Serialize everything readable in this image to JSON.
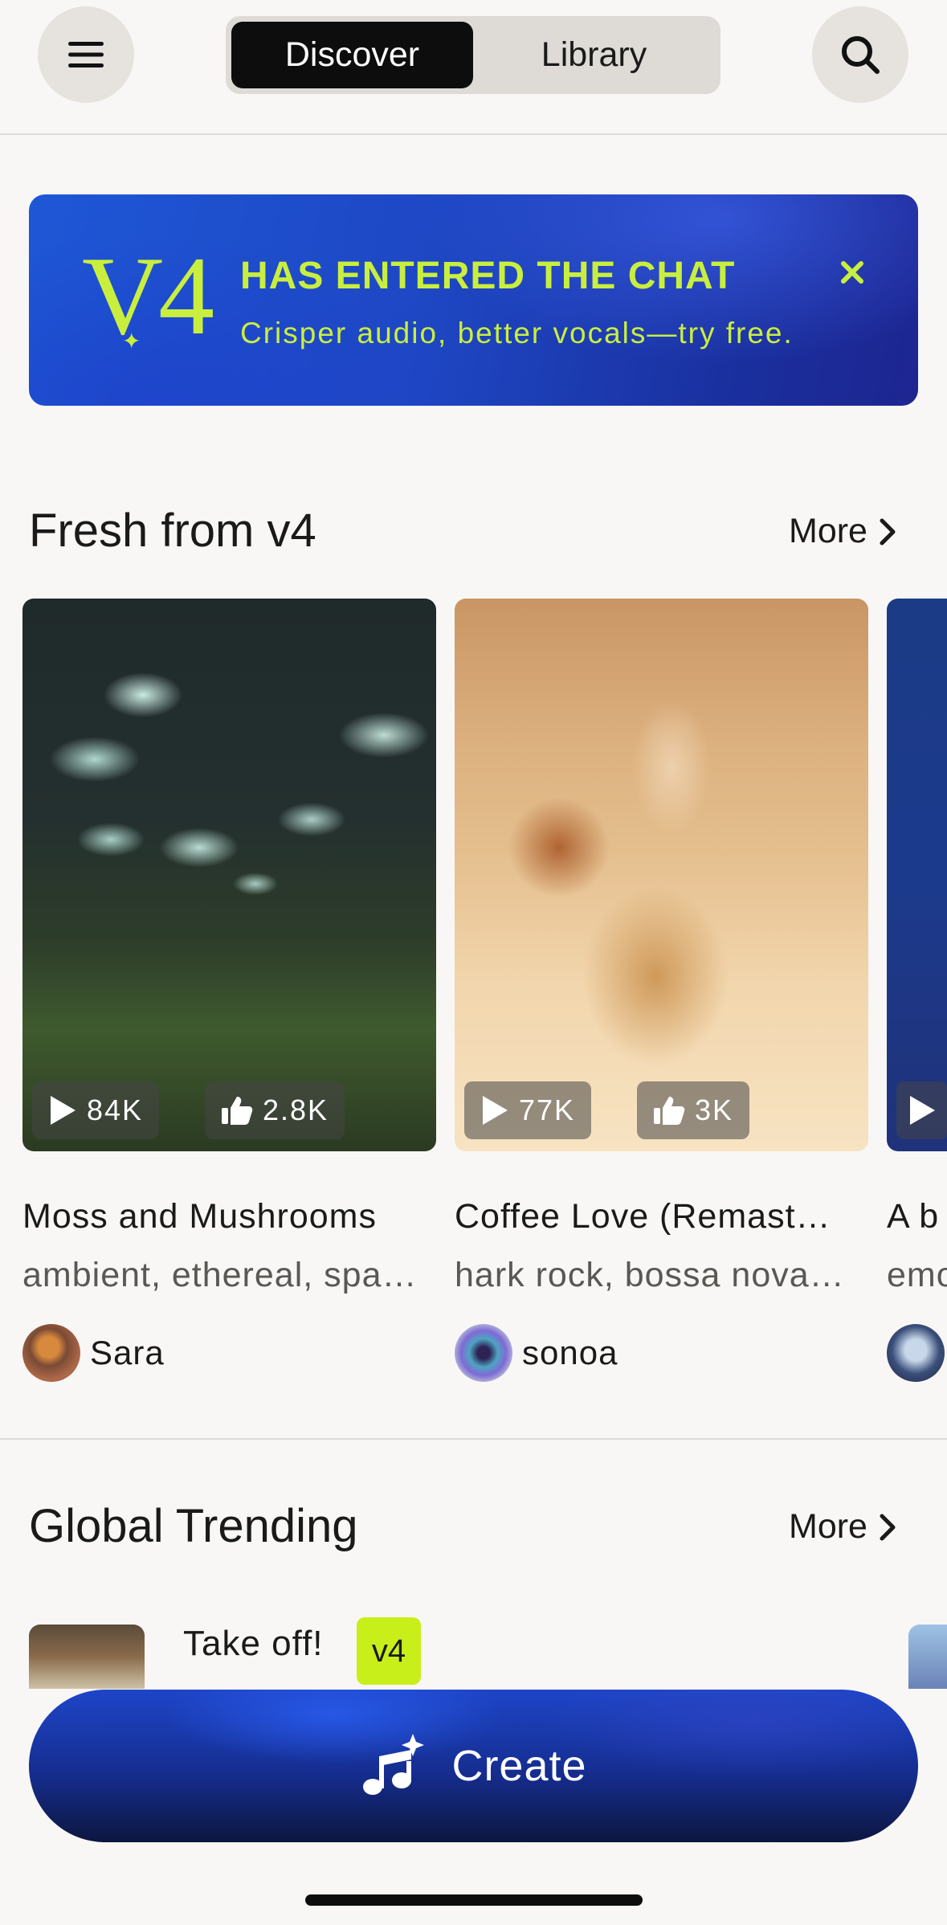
{
  "header": {
    "tabs": [
      {
        "label": "Discover",
        "active": true
      },
      {
        "label": "Library",
        "active": false
      }
    ],
    "menu_icon": "hamburger-menu-icon",
    "search_icon": "search-icon"
  },
  "banner": {
    "logo_text": "V4",
    "title": "HAS ENTERED THE CHAT",
    "subtitle": "Crisper audio, better vocals—try free.",
    "close_icon": "close-icon",
    "accent_color": "#c9ef3e"
  },
  "fresh": {
    "title": "Fresh from v4",
    "more_label": "More",
    "cards": [
      {
        "title": "Moss and Mushrooms",
        "tags": "ambient, ethereal, spa…",
        "plays": "84K",
        "likes": "2.8K",
        "user": "Sara"
      },
      {
        "title": "Coffee Love (Remast…",
        "tags": "hark rock, bossa nova…",
        "plays": "77K",
        "likes": "3K",
        "user": "sonoa"
      },
      {
        "title": "A b",
        "tags": "emo",
        "plays": "",
        "likes": "",
        "user": ""
      }
    ]
  },
  "trending": {
    "title": "Global Trending",
    "more_label": "More",
    "items": [
      {
        "title": "Take off!",
        "badge": "v4"
      }
    ]
  },
  "create": {
    "label": "Create",
    "icon": "music-sparkle-icon"
  }
}
